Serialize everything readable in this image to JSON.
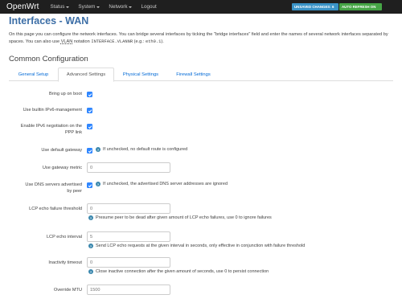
{
  "topbar": {
    "brand": "OpenWrt",
    "menu": [
      {
        "label": "Status",
        "dropdown": true
      },
      {
        "label": "System",
        "dropdown": true
      },
      {
        "label": "Network",
        "dropdown": true
      },
      {
        "label": "Logout",
        "dropdown": false
      }
    ],
    "badge_unsaved": "UNSAVED CHANGES: 6",
    "badge_refresh": "AUTO REFRESH ON"
  },
  "page": {
    "title": "Interfaces - WAN",
    "desc_part1": "On this page you can configure the network interfaces. You can bridge several interfaces by ticking the \"bridge interfaces\" field and enter the names of several network interfaces separated by spaces. You can also use ",
    "desc_vlan": "VLAN",
    "desc_part2": " notation ",
    "desc_notation": "INTERFACE.VLANNR",
    "desc_part3": " (e.g.: ",
    "desc_example": "eth0.1",
    "desc_part4": ").",
    "section_title": "Common Configuration"
  },
  "tabs": [
    {
      "label": "General Setup",
      "active": false
    },
    {
      "label": "Advanced Settings",
      "active": true
    },
    {
      "label": "Physical Settings",
      "active": false
    },
    {
      "label": "Firewall Settings",
      "active": false
    }
  ],
  "form": {
    "bring_up_label": "Bring up on boot",
    "bring_up_checked": true,
    "ipv6_mgmt_label": "Use builtin IPv6-management",
    "ipv6_mgmt_checked": true,
    "ipv6_neg_label_1": "Enable IPv6 negotiation on the",
    "ipv6_neg_label_2": "PPP link",
    "ipv6_neg_checked": true,
    "default_gw_label": "Use default gateway",
    "default_gw_checked": true,
    "default_gw_help": "If unchecked, no default route is configured",
    "gw_metric_label": "Use gateway metric",
    "gw_metric_placeholder": "0",
    "dns_label_1": "Use DNS servers advertised",
    "dns_label_2": "by peer",
    "dns_checked": true,
    "dns_help": "If unchecked, the advertised DNS server addresses are ignored",
    "lcp_fail_label": "LCP echo failure threshold",
    "lcp_fail_placeholder": "0",
    "lcp_fail_help": "Presume peer to be dead after given amount of LCP echo failures, use 0 to ignore failures",
    "lcp_interval_label": "LCP echo interval",
    "lcp_interval_placeholder": "5",
    "lcp_interval_help": "Send LCP echo requests at the given interval in seconds, only effective in conjunction with failure threshold",
    "inactivity_label": "Inactivity timeout",
    "inactivity_placeholder": "0",
    "inactivity_help": "Close inactive connection after the given amount of seconds, use 0 to persist connection",
    "mtu_label": "Override MTU",
    "mtu_placeholder": "1500"
  },
  "colors": {
    "topbar": "#1f1f1f",
    "title": "#3c6ea6",
    "link": "#0069d6",
    "checkbox": "#2f86ff",
    "badge_unsaved": "#3a93c7",
    "badge_refresh": "#46a546"
  }
}
